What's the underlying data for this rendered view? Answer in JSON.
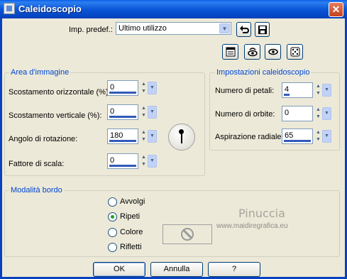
{
  "window": {
    "title": "Caleidoscopio",
    "close_glyph": "✕"
  },
  "preset": {
    "label": "Imp. predef.:",
    "value": "Ultimo utilizzo"
  },
  "area": {
    "legend": "Area d'immagine",
    "fields": [
      {
        "label": "Scostamento orizzontale (%):",
        "value": "0"
      },
      {
        "label": "Scostamento verticale (%):",
        "value": "0"
      },
      {
        "label": "Angolo di rotazione:",
        "value": "180"
      },
      {
        "label": "Fattore di scala:",
        "value": "0"
      }
    ]
  },
  "settings": {
    "legend": "Impostazioni caleidoscopio",
    "fields": [
      {
        "label": "Numero di petali:",
        "value": "4"
      },
      {
        "label": "Numero di orbite:",
        "value": "0"
      },
      {
        "label": "Aspirazione radiale:",
        "value": "65"
      }
    ]
  },
  "border": {
    "legend": "Modalità bordo",
    "options": [
      {
        "label": "Avvolgi",
        "selected": false
      },
      {
        "label": "Ripeti",
        "selected": true
      },
      {
        "label": "Colore",
        "selected": false
      },
      {
        "label": "Rifletti",
        "selected": false
      }
    ]
  },
  "buttons": {
    "ok": "OK",
    "cancel": "Annulla",
    "help": "?"
  },
  "watermark": {
    "name": "Pinuccia",
    "url": "www.maidiregrafica.eu"
  },
  "colors": {
    "accent": "#0046d5",
    "titlebar": "#0b57d8",
    "selected_radio": "#21a121"
  }
}
